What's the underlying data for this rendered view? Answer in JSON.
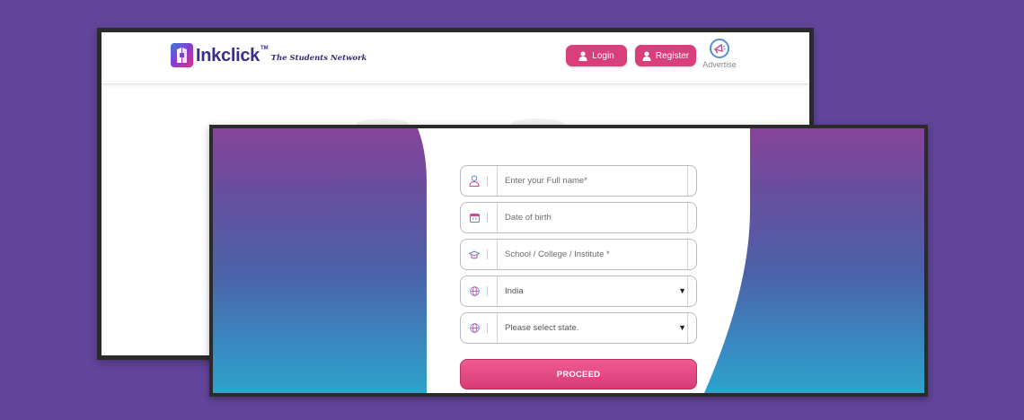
{
  "header": {
    "brand_name": "Inkclick",
    "brand_tm": "TM",
    "tagline": "The Students Network",
    "login_label": "Login",
    "register_label": "Register",
    "advertise_label": "Advertise"
  },
  "form": {
    "full_name_placeholder": "Enter your Full name*",
    "dob_placeholder": "Date of birth",
    "institute_placeholder": "School / College / Institute  *",
    "country_value": "India",
    "state_value": "Please select state.",
    "proceed_label": "PROCEED"
  },
  "icons": {
    "full_name": "user-icon",
    "dob": "calendar-icon",
    "institute": "graduation-cap-icon",
    "country": "globe-icon",
    "state": "globe-icon",
    "advertise": "megaphone-icon",
    "caret": "▼"
  },
  "colors": {
    "background": "#62449a",
    "accent_pink": "#d93f7a",
    "brand_purple": "#3a2f88",
    "gradient_top": "#874499",
    "gradient_bottom": "#2ea3cc"
  }
}
